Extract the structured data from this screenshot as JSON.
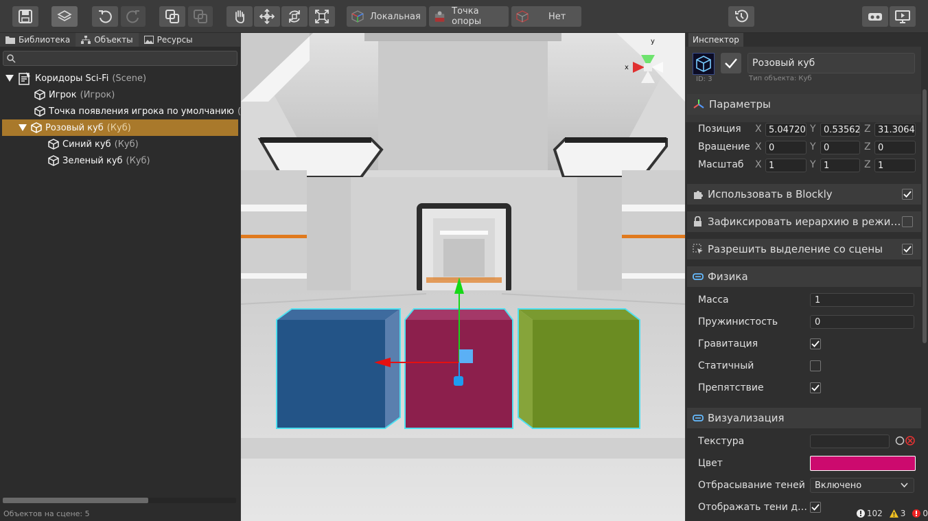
{
  "toolbar": {
    "coords_label": "Локальная",
    "pivot_label": "Точка опоры",
    "snap_label": "Нет"
  },
  "left_panel": {
    "tabs": [
      {
        "label": "Библиотека"
      },
      {
        "label": "Объекты"
      },
      {
        "label": "Ресурсы"
      }
    ],
    "search_placeholder": "",
    "tree": [
      {
        "name": "Коридоры Sci-Fi",
        "type": "(Scene)"
      },
      {
        "name": "Игрок",
        "type": "(Игрок)"
      },
      {
        "name": "Точка появления игрока по умолчанию",
        "type": "(Точка"
      },
      {
        "name": "Розовый куб",
        "type": "(Куб)"
      },
      {
        "name": "Синий куб",
        "type": "(Куб)"
      },
      {
        "name": "Зеленый куб",
        "type": "(Куб)"
      }
    ],
    "status": "Объектов на сцене: 5"
  },
  "viewport": {
    "gizmo_y": "y",
    "gizmo_x": "x"
  },
  "inspector": {
    "tab": "Инспектор",
    "object_name": "Розовый куб",
    "object_id": "ID: 3",
    "object_type": "Тип объекта: Куб",
    "params_title": "Параметры",
    "position_label": "Позиция",
    "rotation_label": "Вращение",
    "scale_label": "Масштаб",
    "axis_x": "X",
    "axis_y": "Y",
    "axis_z": "Z",
    "position": [
      "5.04720",
      "0.53562",
      "31.3064"
    ],
    "rotation": [
      "0",
      "0",
      "0"
    ],
    "scale": [
      "1",
      "1",
      "1"
    ],
    "blockly": "Использовать в Blockly",
    "lock_hierarchy": "Зафиксировать иерархию в режи…",
    "allow_select": "Разрешить выделение со сцены",
    "physics_title": "Физика",
    "mass_label": "Масса",
    "mass": "1",
    "bounce_label": "Пружинистость",
    "bounce": "0",
    "gravity_label": "Гравитация",
    "static_label": "Статичный",
    "obstacle_label": "Препятствие",
    "visual_title": "Визуализация",
    "texture_label": "Текстура",
    "color_label": "Цвет",
    "color_value": "#cc0a6e",
    "cast_shadows_label": "Отбрасывание теней",
    "cast_shadows": "Включено",
    "receive_shadows_label": "Отображать тени д…",
    "counters": {
      "info": "102",
      "warn": "3",
      "err": "0"
    }
  }
}
